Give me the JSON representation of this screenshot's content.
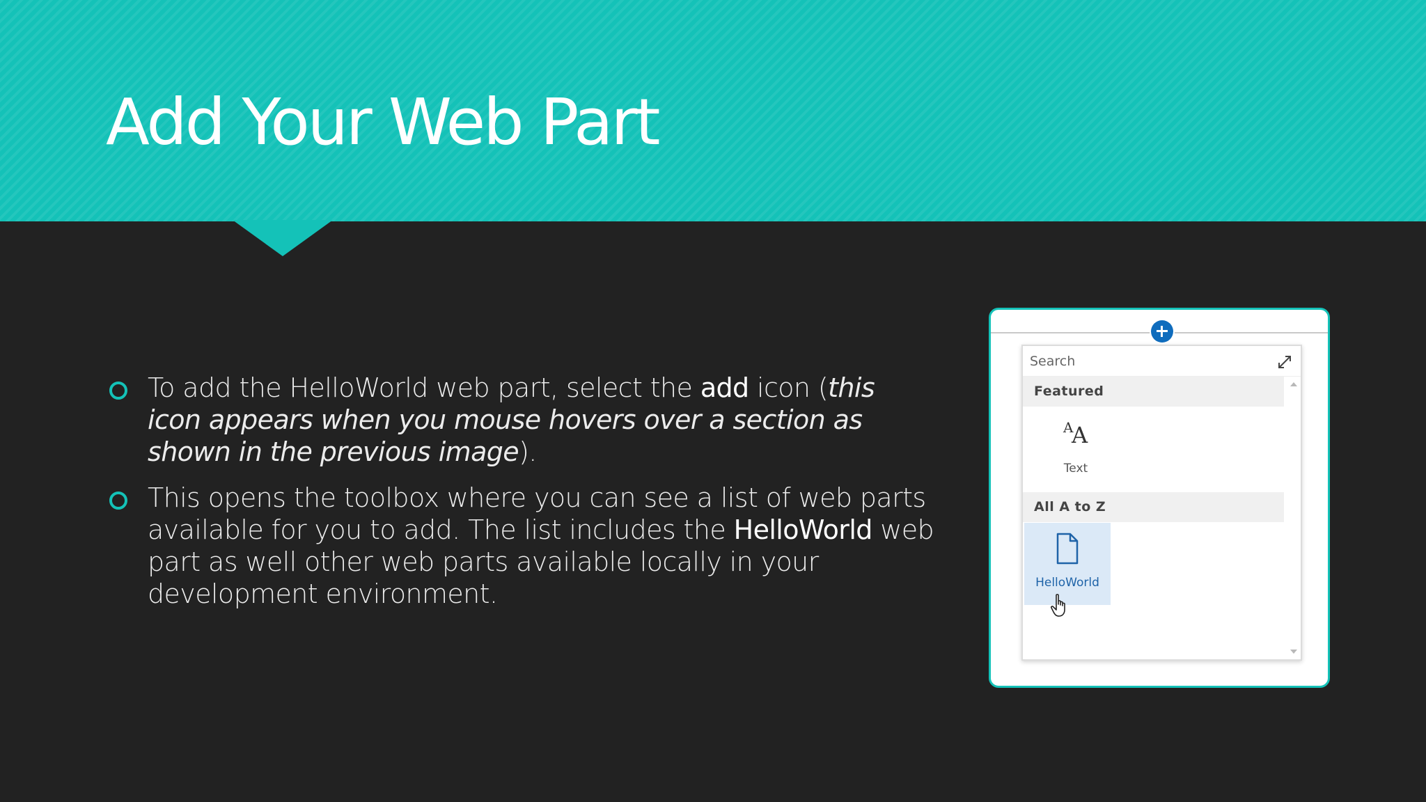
{
  "slide": {
    "title": "Add Your Web Part",
    "bullets": [
      {
        "parts": [
          {
            "text": "To add the HelloWorld web part, select the ",
            "style": "normal"
          },
          {
            "text": "add",
            "style": "bold"
          },
          {
            "text": " icon (",
            "style": "normal"
          },
          {
            "text": "this icon appears when you mouse hovers over a section as shown in the previous image",
            "style": "italic"
          },
          {
            "text": ").",
            "style": "normal"
          }
        ]
      },
      {
        "parts": [
          {
            "text": "This opens the toolbox where you can see a list of web parts available for you to add. The list includes the ",
            "style": "normal"
          },
          {
            "text": "HelloWorld",
            "style": "bold"
          },
          {
            "text": " web part as well other web parts available locally in your development environment.",
            "style": "normal"
          }
        ]
      }
    ]
  },
  "toolbox": {
    "search": {
      "placeholder": "Search",
      "value": ""
    },
    "featured_header": "Featured",
    "featured_items": [
      {
        "label": "Text",
        "icon": "text-font-icon"
      }
    ],
    "all_header": "All A to Z",
    "all_items": [
      {
        "label": "HelloWorld",
        "icon": "document-icon",
        "selected": true
      }
    ]
  },
  "colors": {
    "accent": "#14c2b8",
    "background": "#222222",
    "add_button": "#0f6cbd",
    "selected_tile": "#dbe9f7"
  }
}
